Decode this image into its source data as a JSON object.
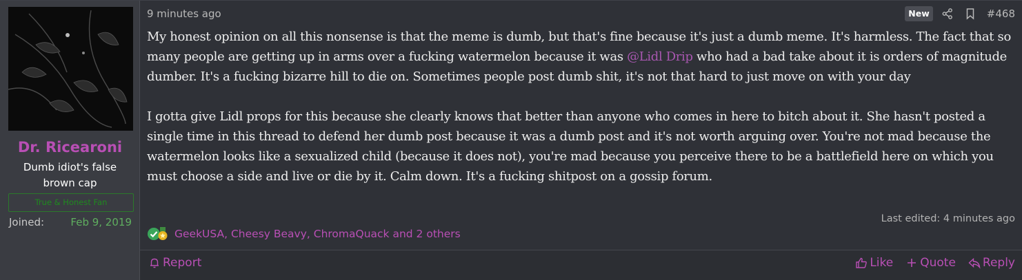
{
  "user": {
    "name": "Dr. Ricearoni",
    "title": "Dumb idiot's false brown cap",
    "banner": "True & Honest Fan",
    "joined_label": "Joined:",
    "joined_value": "Feb 9, 2019"
  },
  "post": {
    "timestamp": "9 minutes ago",
    "badge": "New",
    "number": "#468",
    "paragraph1_a": "My honest opinion on all this nonsense is that the meme is dumb, but that's fine because it's just a dumb meme. It's harmless. The fact that so many people are getting up in arms over a fucking watermelon because it was ",
    "mention": "@Lidl Drip",
    "paragraph1_b": " who had a bad take about it is orders of magnitude dumber. It's a fucking bizarre hill to die on. Sometimes people post dumb shit, it's not that hard to just move on with your day",
    "paragraph2": "I gotta give Lidl props for this because she clearly knows that better than anyone who comes in here to bitch about it. She hasn't posted a single time in this thread to defend her dumb post because it was a dumb post and it's not worth arguing over. You're not mad because the watermelon looks like a sexualized child (because it does not), you're mad because you perceive there to be a battlefield here on which you must choose a side and live or die by it. Calm down. It's a fucking shitpost on a gossip forum.",
    "last_edited": "Last edited: 4 minutes ago"
  },
  "reactions": {
    "icons": [
      "check-reaction-icon",
      "medal-reaction-icon"
    ],
    "list": "GeekUSA, Cheesy Beavy, ChromaQuack and 2 others"
  },
  "footer": {
    "report": "Report",
    "like": "Like",
    "quote": "Quote",
    "reply": "Reply"
  },
  "colors": {
    "accent": "#b94fb5",
    "background": "#2f3137",
    "sidebar": "#3a3c42",
    "joined_green": "#5fae5f"
  }
}
